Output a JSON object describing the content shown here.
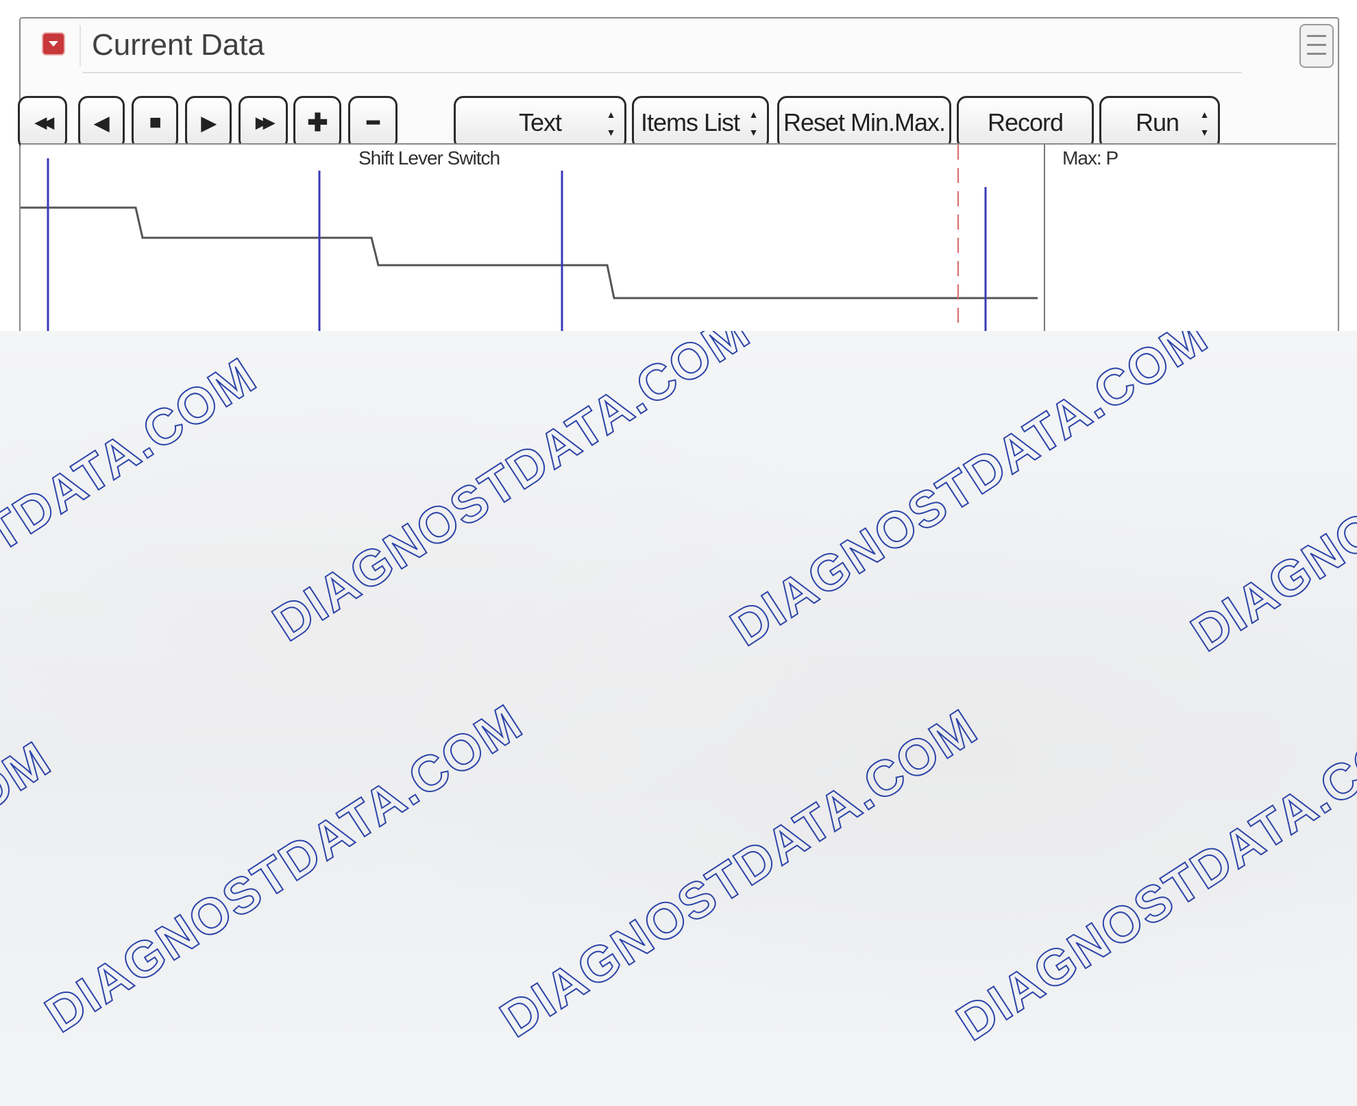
{
  "window": {
    "title": "Current Data"
  },
  "toolbar": {
    "nav_buttons": [
      {
        "name": "rewind-button",
        "icon": "rewind-icon",
        "glyph": "◀◀"
      },
      {
        "name": "step-back-button",
        "icon": "step-back-icon",
        "glyph": "◀"
      },
      {
        "name": "stop-button",
        "icon": "stop-icon",
        "glyph": "■"
      },
      {
        "name": "play-button",
        "icon": "play-icon",
        "glyph": "▶"
      },
      {
        "name": "fast-forward-button",
        "icon": "fast-forward-icon",
        "glyph": "▶▶"
      },
      {
        "name": "zoom-in-button",
        "icon": "plus-icon",
        "glyph": "✚"
      },
      {
        "name": "zoom-out-button",
        "icon": "minus-icon",
        "glyph": "━"
      }
    ],
    "view_select": "Text",
    "items_list_select": "Items List",
    "reset_button": "Reset Min.Max.",
    "record_button": "Record",
    "run_select": "Run"
  },
  "graph": {
    "title": "Shift Lever Switch",
    "side_label": "Max: P"
  },
  "watermark": {
    "text": "DIAGNOSTDATA.COM",
    "color": "#2c44a8"
  },
  "colors": {
    "accent_red": "#c8373a",
    "cursor_blue": "#3a3ab8",
    "marker_red": "#d86a6a",
    "trace": "#555555"
  }
}
